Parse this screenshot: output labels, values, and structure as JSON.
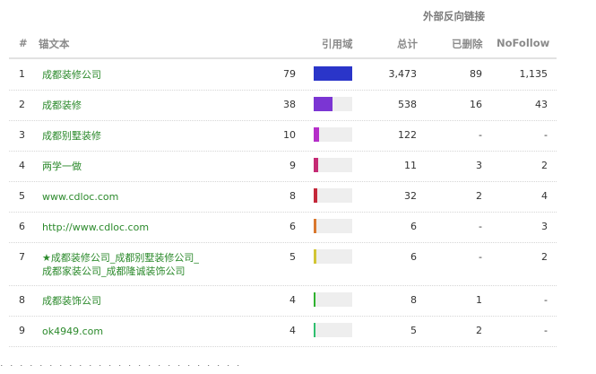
{
  "table": {
    "group_header": "外部反向链接",
    "headers": {
      "index": "#",
      "anchor": "锚文本",
      "ref_domains": "引用域",
      "total": "总计",
      "deleted": "已删除",
      "nofollow": "NoFollow"
    },
    "rows": [
      {
        "index": "1",
        "anchor_lines": [
          "成都装修公司"
        ],
        "ref_domains": "79",
        "share": 1.0,
        "bar_color": "#2a35c9",
        "total": "3,473",
        "deleted": "89",
        "nofollow": "1,135"
      },
      {
        "index": "2",
        "anchor_lines": [
          "成都装修"
        ],
        "ref_domains": "38",
        "share": 0.48,
        "bar_color": "#7b35d3",
        "total": "538",
        "deleted": "16",
        "nofollow": "43"
      },
      {
        "index": "3",
        "anchor_lines": [
          "成都别墅装修"
        ],
        "ref_domains": "10",
        "share": 0.13,
        "bar_color": "#b52ec9",
        "total": "122",
        "deleted": "-",
        "nofollow": "-"
      },
      {
        "index": "4",
        "anchor_lines": [
          "两学一做"
        ],
        "ref_domains": "9",
        "share": 0.11,
        "bar_color": "#c52a74",
        "total": "11",
        "deleted": "3",
        "nofollow": "2"
      },
      {
        "index": "5",
        "anchor_lines": [
          "www.cdloc.com"
        ],
        "ref_domains": "8",
        "share": 0.1,
        "bar_color": "#c4283a",
        "total": "32",
        "deleted": "2",
        "nofollow": "4"
      },
      {
        "index": "6",
        "anchor_lines": [
          "http://www.cdloc.com"
        ],
        "ref_domains": "6",
        "share": 0.08,
        "bar_color": "#d9782e",
        "total": "6",
        "deleted": "-",
        "nofollow": "3"
      },
      {
        "index": "7",
        "anchor_lines": [
          "★成都装修公司_成都别墅装修公司_",
          "成都家装公司_成都隆诚装饰公司"
        ],
        "ref_domains": "5",
        "share": 0.06,
        "bar_color": "#d2c534",
        "total": "6",
        "deleted": "-",
        "nofollow": "2"
      },
      {
        "index": "8",
        "anchor_lines": [
          "成都装饰公司"
        ],
        "ref_domains": "4",
        "share": 0.05,
        "bar_color": "#2fb22f",
        "total": "8",
        "deleted": "1",
        "nofollow": "-"
      },
      {
        "index": "9",
        "anchor_lines": [
          "ok4949.com"
        ],
        "ref_domains": "4",
        "share": 0.05,
        "bar_color": "#2fbf6f",
        "total": "5",
        "deleted": "2",
        "nofollow": "-"
      }
    ]
  }
}
